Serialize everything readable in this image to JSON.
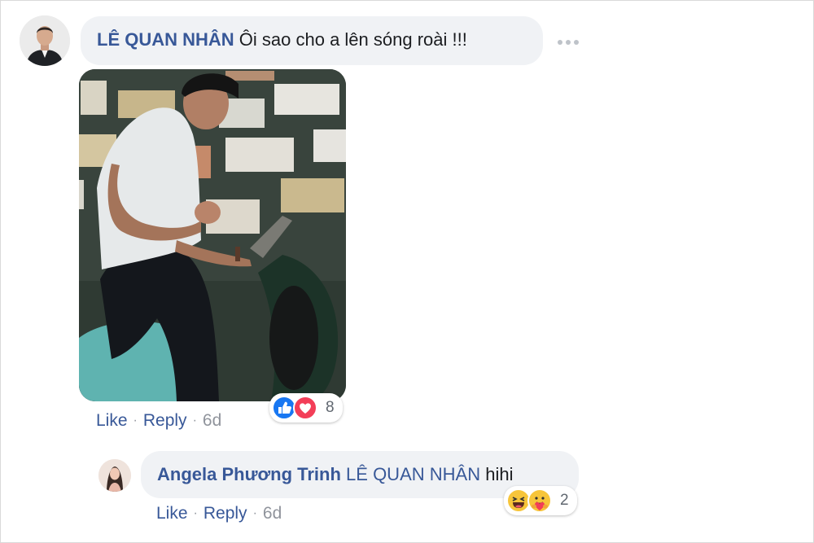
{
  "comment": {
    "author": "LÊ QUAN NHÂN",
    "text": "Ôi sao cho a lên sóng roài !!!",
    "actions": {
      "like": "Like",
      "separator": "·",
      "reply": "Reply",
      "time": "6d"
    },
    "reactions": {
      "icons": [
        "like-icon",
        "love-icon"
      ],
      "count": "8",
      "colors": {
        "like": "#1877f2",
        "love": "#f33e58"
      }
    },
    "photo": {
      "icon": "photo-attachment"
    }
  },
  "reply": {
    "author": "Angela Phương Trinh",
    "mention": "LÊ QUAN NHÂN",
    "text": "hihi",
    "actions": {
      "like": "Like",
      "separator": "·",
      "reply": "Reply",
      "time": "6d"
    },
    "reactions": {
      "icons": [
        "haha-icon",
        "care-icon"
      ],
      "count": "2"
    }
  },
  "colors": {
    "link": "#385898",
    "bubble": "#f0f2f5",
    "meta": "#90949c"
  }
}
